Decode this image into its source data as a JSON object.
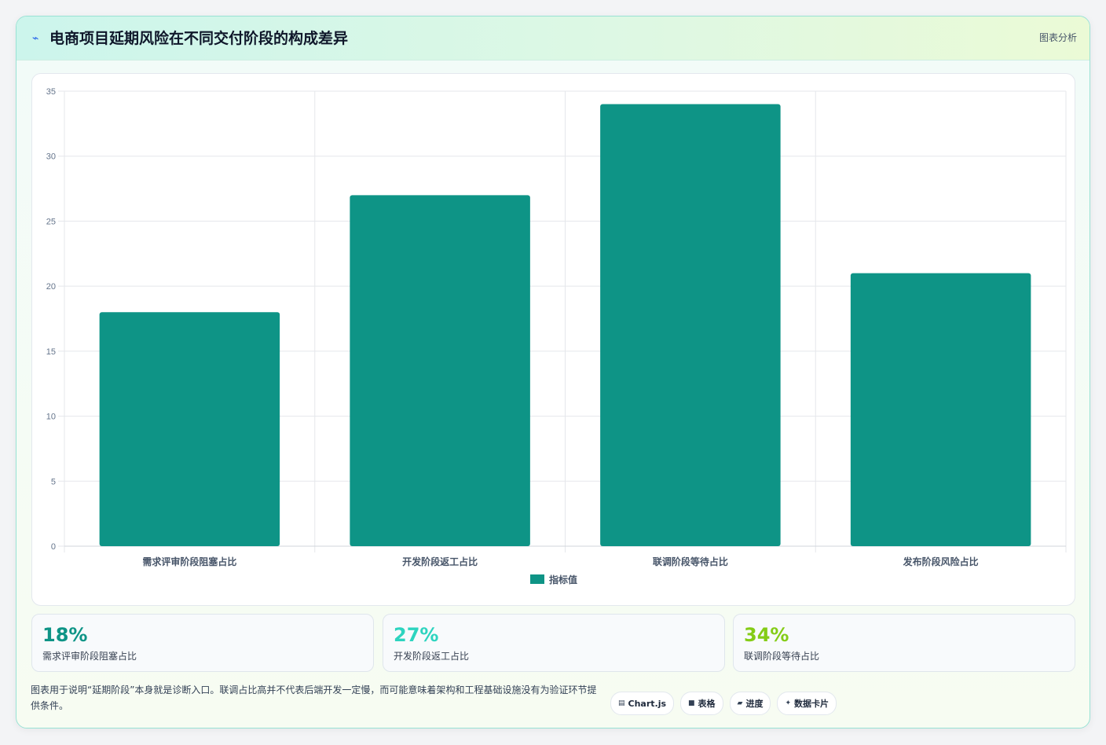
{
  "header": {
    "icon": "chart-spark-icon",
    "title": "电商项目延期风险在不同交付阶段的构成差异",
    "tag": "图表分析"
  },
  "chart_data": {
    "type": "bar",
    "categories": [
      "需求评审阶段阻塞占比",
      "开发阶段返工占比",
      "联调阶段等待占比",
      "发布阶段风险占比"
    ],
    "series": [
      {
        "name": "指标值",
        "values": [
          18,
          27,
          34,
          21
        ]
      }
    ],
    "ylim": [
      0,
      35
    ],
    "yticks": [
      0,
      5,
      10,
      15,
      20,
      25,
      30,
      35
    ],
    "grid": true,
    "legend": "bottom",
    "bar_color": "#0e9486"
  },
  "stats": [
    {
      "value": "18%",
      "label": "需求评审阶段阻塞占比",
      "color": "#0e9486"
    },
    {
      "value": "27%",
      "label": "开发阶段返工占比",
      "color": "#2dd4bf"
    },
    {
      "value": "34%",
      "label": "联调阶段等待占比",
      "color": "#84cc16"
    }
  ],
  "note": "图表用于说明“延期阶段”本身就是诊断入口。联调占比高并不代表后端开发一定慢，而可能意味着架构和工程基础设施没有为验证环节提供条件。",
  "badges": [
    {
      "icon": "chart-icon",
      "glyph": "▤",
      "label": "Chart.js"
    },
    {
      "icon": "table-icon",
      "glyph": "■",
      "label": "表格"
    },
    {
      "icon": "progress-icon",
      "glyph": "▰",
      "label": "进度"
    },
    {
      "icon": "sparkle-icon",
      "glyph": "✦",
      "label": "数据卡片"
    }
  ]
}
